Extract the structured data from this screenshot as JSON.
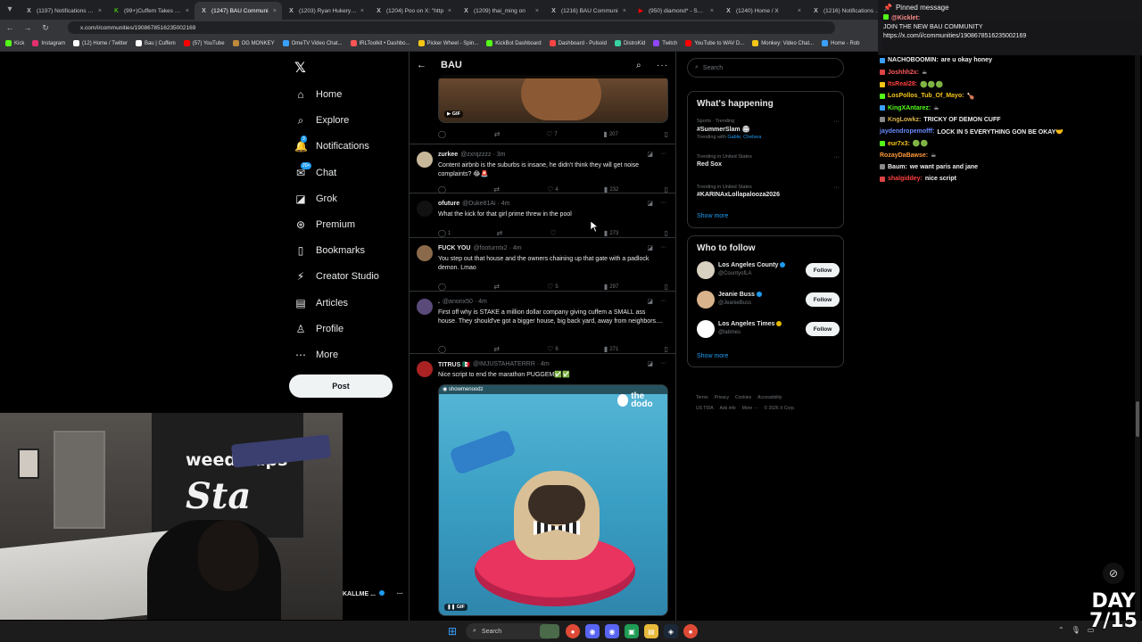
{
  "browser": {
    "tabs": [
      {
        "title": "(1197) Notifications / X",
        "icon": "x-icon",
        "active": false
      },
      {
        "title": "(99+)Cuffem Takes Bre",
        "icon": "kick-icon",
        "active": false
      },
      {
        "title": "(1247) BAU Communi",
        "icon": "x-icon",
        "active": true
      },
      {
        "title": "(1203) Ryan Hukery on",
        "icon": "x-icon",
        "active": false
      },
      {
        "title": "(1204) Poo on X: \"http",
        "icon": "x-icon",
        "active": false
      },
      {
        "title": "(1209) thai_ming on",
        "icon": "x-icon",
        "active": false
      },
      {
        "title": "(1216) BAU Communi",
        "icon": "x-icon",
        "active": false
      },
      {
        "title": "(950) diamond* - STFU",
        "icon": "youtube-icon",
        "active": false
      },
      {
        "title": "(1240) Home / X",
        "icon": "x-icon",
        "active": false
      },
      {
        "title": "(1216) Notifications / X",
        "icon": "x-icon",
        "active": false
      }
    ],
    "url": "x.com/i/communities/1908678516235002169",
    "bookmarks": [
      {
        "label": "Kick",
        "color": "#53fc18"
      },
      {
        "label": "Instagram",
        "color": "#e1306c"
      },
      {
        "label": "(12) Home / Twitter",
        "color": "#ffffff"
      },
      {
        "label": "Bau | Cuffem",
        "color": "#ffffff"
      },
      {
        "label": "(57) YouTube",
        "color": "#ff0000"
      },
      {
        "label": "OG MONKEY",
        "color": "#c08a3a"
      },
      {
        "label": "OmeTV Video Chat...",
        "color": "#3aa0ff"
      },
      {
        "label": "IRLToolkit • Dashbo...",
        "color": "#ff5555"
      },
      {
        "label": "Picker Wheel - Spin...",
        "color": "#f5c518"
      },
      {
        "label": "KickBot Dashboard",
        "color": "#53fc18"
      },
      {
        "label": "Dashboard - Pulsoid",
        "color": "#ff4444"
      },
      {
        "label": "DistroKid",
        "color": "#3ad1a0"
      },
      {
        "label": "Twitch",
        "color": "#9146ff"
      },
      {
        "label": "YouTube to WAV D...",
        "color": "#ff0000"
      },
      {
        "label": "Monkey: Video Chat...",
        "color": "#f5c518"
      },
      {
        "label": "Home - Rob",
        "color": "#3aa0ff"
      }
    ]
  },
  "nav": {
    "items": [
      {
        "label": "Home",
        "icon": "home-icon",
        "glyph": "⌂"
      },
      {
        "label": "Explore",
        "icon": "search-icon",
        "glyph": "⌕"
      },
      {
        "label": "Notifications",
        "icon": "bell-icon",
        "glyph": "🔔",
        "badge": "3"
      },
      {
        "label": "Chat",
        "icon": "chat-icon",
        "glyph": "✉",
        "badge": "20+"
      },
      {
        "label": "Grok",
        "icon": "grok-icon",
        "glyph": "◪"
      },
      {
        "label": "Premium",
        "icon": "premium-icon",
        "glyph": "⊛"
      },
      {
        "label": "Bookmarks",
        "icon": "bookmark-icon",
        "glyph": "▯"
      },
      {
        "label": "Creator Studio",
        "icon": "creator-studio-icon",
        "glyph": "⚡"
      },
      {
        "label": "Articles",
        "icon": "articles-icon",
        "glyph": "▤"
      },
      {
        "label": "Profile",
        "icon": "profile-icon",
        "glyph": "♙"
      },
      {
        "label": "More",
        "icon": "more-icon",
        "glyph": "⋯"
      }
    ],
    "post_label": "Post",
    "account_name": "KALLME ..."
  },
  "feed": {
    "title": "BAU",
    "gif_label": "GIF",
    "tweets": [
      {
        "name": "zurkee",
        "handle": "@zxrqzzzz · 3m",
        "text": "Content airbnb is the suburbs is insane, he didn't think they will get noise complaints? 😂🚨",
        "reply": "",
        "retweet": "",
        "like": "4",
        "views": "232",
        "avatar": "#c8b89a"
      },
      {
        "name": "ofuture",
        "handle": "@Duke81Ai · 4m",
        "text": "What the kick for that girl prime threw in the pool",
        "reply": "1",
        "retweet": "",
        "like": "",
        "views": "273",
        "avatar": "#111111"
      },
      {
        "name": "FUCK YOU",
        "handle": "@footurntx2 · 4m",
        "text": "You step out that house and the owners chaining up that gate with a padlock demon. Lmao",
        "reply": "",
        "retweet": "",
        "like": "5",
        "views": "297",
        "avatar": "#8a6a4a"
      },
      {
        "name": ".",
        "handle": "@anonx50 · 4m",
        "text": "First off why is STAKE a million dollar company giving cuffem a SMALL ass house. They should've got a bigger house, big back yard, away from neighbors....",
        "reply": "",
        "retweet": "",
        "like": "6",
        "views": "271",
        "avatar": "#5a4a7a"
      },
      {
        "name": "TITRUS 🇲🇽",
        "handle": "@IMJUSTAHATERRR · 4m",
        "text": "Nice script to end the marathon PUGGEM✅✅",
        "avatar": "#aa2222",
        "media_source": "showmenoodz",
        "media_brand": "the dodo"
      }
    ],
    "top_tweet_actions": {
      "reply": "",
      "retweet": "",
      "like": "7",
      "views": "207"
    }
  },
  "right": {
    "search_placeholder": "Search",
    "happening_title": "What's happening",
    "trends": [
      {
        "meta": "Sports · Trending",
        "name": "#SummerSlam 🏟",
        "sub_prefix": "Trending with ",
        "sub_links": "Gable, Chelsea"
      },
      {
        "meta": "Trending in United States",
        "name": "Red Sox",
        "sub_prefix": "",
        "sub_links": ""
      },
      {
        "meta": "Trending in United States",
        "name": "#KARINAxLollapalooza2026",
        "sub_prefix": "",
        "sub_links": ""
      }
    ],
    "show_more": "Show more",
    "who_to_follow_title": "Who to follow",
    "follow": [
      {
        "name": "Los Angeles County",
        "handle": "@CountyofLA",
        "badge": "blue",
        "avatar": "#d8d0c0"
      },
      {
        "name": "Jeanie Buss",
        "handle": "@JeanieBuss",
        "badge": "blue",
        "avatar": "#d9b38c"
      },
      {
        "name": "Los Angeles Times",
        "handle": "@latimes",
        "badge": "gold",
        "avatar": "#ffffff"
      }
    ],
    "follow_label": "Follow",
    "footer": [
      "Terms",
      "Privacy",
      "Cookies",
      "Accessibility",
      "US TIDA",
      "Ads info",
      "More ···",
      "© 2026 X Corp."
    ]
  },
  "chat": {
    "pinned_title": "Pinned message",
    "pinned_user": "@Kicklet:",
    "pinned_text": "JOIN THE NEW BAU COMMUNITY",
    "pinned_link": "https://x.com/i/communities/1908678516235002169",
    "messages": [
      {
        "user": "NACHOBOOMIN:",
        "text": "are u okay honey",
        "color": "#efeff1",
        "badge": "#3aa0ff"
      },
      {
        "user": "Joshhh2x:",
        "text": "☕",
        "color": "#ff5c5c",
        "badge": "#d44"
      },
      {
        "user": "ItsReal28:",
        "text": "🟢🟢🟢",
        "color": "#ff4040",
        "badge": "#f5c518"
      },
      {
        "user": "LosPollos_Tub_Of_Mayo:",
        "text": "🍗",
        "color": "#f5c518",
        "badge": "#53fc18"
      },
      {
        "user": "KingXAntarez:",
        "text": "☕",
        "color": "#53fc18",
        "badge": "#3aa0ff"
      },
      {
        "user": "KngLowkz:",
        "text": "TRICKY OF DEMON CUFF",
        "color": "#d8b24a",
        "badge": "#888"
      },
      {
        "user": "jaydendropemofff:",
        "text": "LOCK IN 5 EVERYTHING GON BE OKAY🤝",
        "color": "#6a8aff",
        "badge": ""
      },
      {
        "user": "eur7x3:",
        "text": "🟢🟢",
        "color": "#f5c518",
        "badge": "#53fc18"
      },
      {
        "user": "RozayDaBawse:",
        "text": "☕",
        "color": "#ff9a3a",
        "badge": ""
      },
      {
        "user": "Baum:",
        "text": "we want paris and jane",
        "color": "#efeff1",
        "badge": "#888"
      },
      {
        "user": "shalgiddey:",
        "text": "nice script",
        "color": "#ff4040",
        "badge": "#d44"
      }
    ]
  },
  "overlay": {
    "day_label": "DAY",
    "day_value": "7/15",
    "webcam_banner_brand": "weedmaps",
    "webcam_banner_text": "Sta"
  },
  "taskbar": {
    "search_placeholder": "Search"
  }
}
